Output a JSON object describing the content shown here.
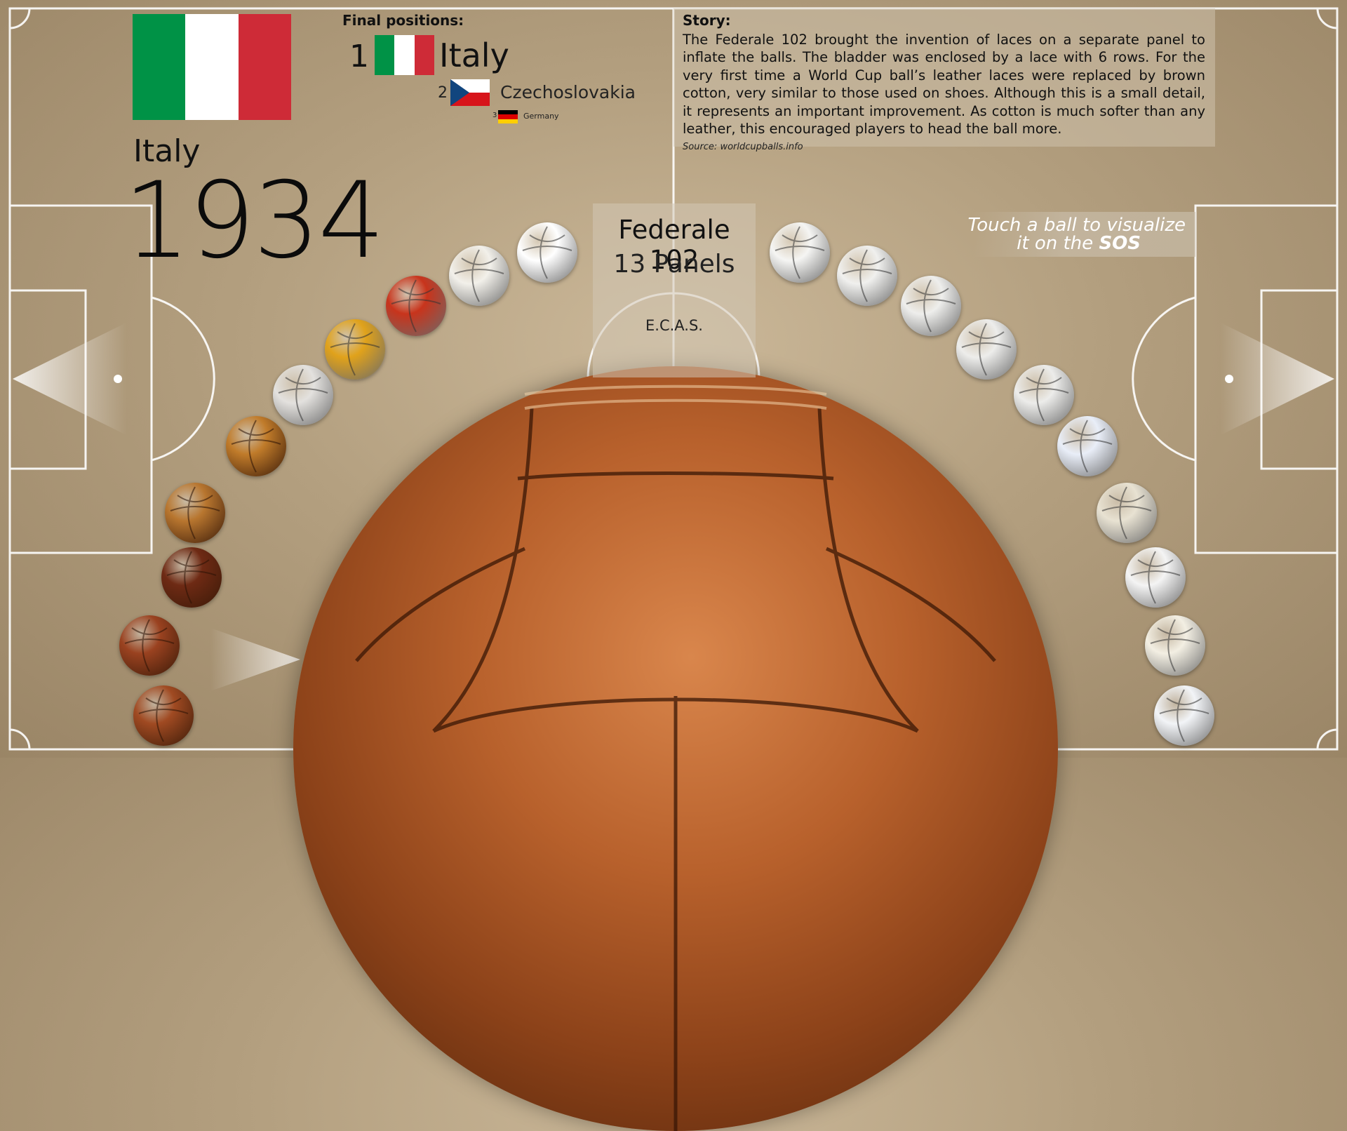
{
  "hero": {
    "country": "Italy",
    "year": "1934"
  },
  "final_positions": {
    "title": "Final positions:",
    "places": [
      {
        "rank": "1",
        "team": "Italy",
        "flag_colors": [
          "#009246",
          "#ffffff",
          "#ce2b37"
        ]
      },
      {
        "rank": "2",
        "team": "Czechoslovakia",
        "flag_colors": [
          "#ffffff",
          "#d7141a",
          "#11457e"
        ]
      },
      {
        "rank": "3",
        "team": "Germany",
        "flag_colors": [
          "#000000",
          "#dd0000",
          "#ffce00"
        ]
      }
    ]
  },
  "story": {
    "title": "Story:",
    "text": "The Federale 102 brought the invention of laces on a separate panel to inflate the balls. The bladder was enclosed by a lace with 6 rows. For the very first time a World Cup ball’s leather laces were replaced by brown cotton, very similar to those used on shoes. Although this is a small detail, it represents an important improvement. As cotton  is much softer than any leather, this encouraged players to head the ball more.",
    "source": "Source: worldcupballs.info"
  },
  "selected_ball": {
    "name": "Federale 102",
    "panels": "13 Panels",
    "maker": "E.C.A.S."
  },
  "hint": {
    "line1": "Touch a ball to visualize",
    "line2_prefix": "it on the ",
    "line2_bold": "SOS"
  },
  "colors": {
    "hero_flag": [
      "#009246",
      "#ffffff",
      "#ce2b37"
    ],
    "pitch_line": "#ffffff",
    "background": "#b39f7f"
  },
  "left_balls": [
    {
      "color": "#a04a22",
      "icon": "ball-1930-icon"
    },
    {
      "color": "#9a4220",
      "icon": "ball-1934-icon"
    },
    {
      "color": "#6e2a14",
      "icon": "ball-1938-icon"
    },
    {
      "color": "#b8762f",
      "icon": "ball-1950-icon"
    },
    {
      "color": "#c07b2a",
      "icon": "ball-1954-icon"
    },
    {
      "color": "#e3e1de",
      "icon": "ball-1958-icon"
    },
    {
      "color": "#e0a21b",
      "icon": "ball-1962-icon"
    },
    {
      "color": "#c8341c",
      "icon": "ball-1966-icon"
    },
    {
      "color": "#f2f0ea",
      "icon": "ball-1970-icon"
    },
    {
      "color": "#ffffff",
      "icon": "ball-1974-icon"
    }
  ],
  "right_balls": [
    {
      "color": "#f5f5f3",
      "icon": "ball-1978-icon"
    },
    {
      "color": "#f0f0ee",
      "icon": "ball-1982-icon"
    },
    {
      "color": "#eeeeec",
      "icon": "ball-1986-icon"
    },
    {
      "color": "#ededeb",
      "icon": "ball-1990-icon"
    },
    {
      "color": "#ececea",
      "icon": "ball-1994-icon"
    },
    {
      "color": "#e9eef8",
      "icon": "ball-1998-icon"
    },
    {
      "color": "#e8e2d2",
      "icon": "ball-2002-icon"
    },
    {
      "color": "#f4f4f4",
      "icon": "ball-2006-icon"
    },
    {
      "color": "#f3efe3",
      "icon": "ball-2010-icon"
    },
    {
      "color": "#f2f4f7",
      "icon": "ball-2014-icon"
    }
  ]
}
